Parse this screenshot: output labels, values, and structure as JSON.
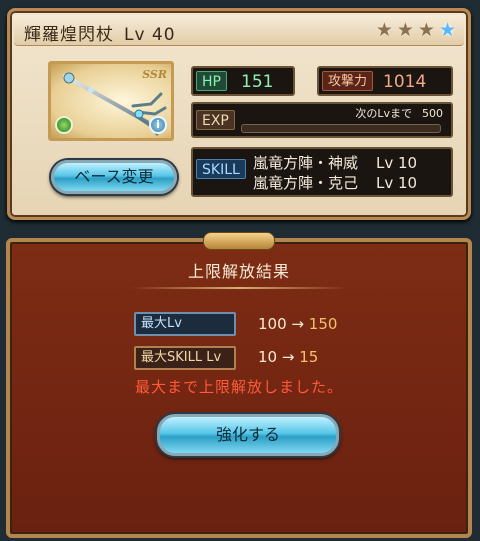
{
  "weapon": {
    "name": "輝羅煌閃杖",
    "level_text": "Lv 40",
    "rarity": "SSR",
    "stars": [
      "filled",
      "filled",
      "filled",
      "blue"
    ]
  },
  "stats": {
    "hp_label": "HP",
    "hp_value": "151",
    "atk_label": "攻撃力",
    "atk_value": "1014",
    "exp_label": "EXP",
    "exp_next_label": "次のLvまで",
    "exp_next_value": "500",
    "exp_progress": 0.0
  },
  "skills": {
    "label": "SKILL",
    "items": [
      {
        "name": "嵐竜方陣・神威",
        "level": "Lv 10"
      },
      {
        "name": "嵐竜方陣・克己",
        "level": "Lv 10"
      }
    ]
  },
  "buttons": {
    "base_change": "ベース変更",
    "enhance": "強化する"
  },
  "result": {
    "title": "上限解放結果",
    "max_lv_label": "最大Lv",
    "max_lv_from": "100",
    "max_lv_to": "150",
    "max_skill_label": "最大SKILL Lv",
    "max_skill_from": "10",
    "max_skill_to": "15",
    "arrow": "→",
    "notice": "最大まで上限解放しました。"
  },
  "colors": {
    "panel_bg": "#7e2c14",
    "button_blue": "#58c6e8",
    "notice_red": "#ff5a3a",
    "new_value_gold": "#f2c36a"
  }
}
